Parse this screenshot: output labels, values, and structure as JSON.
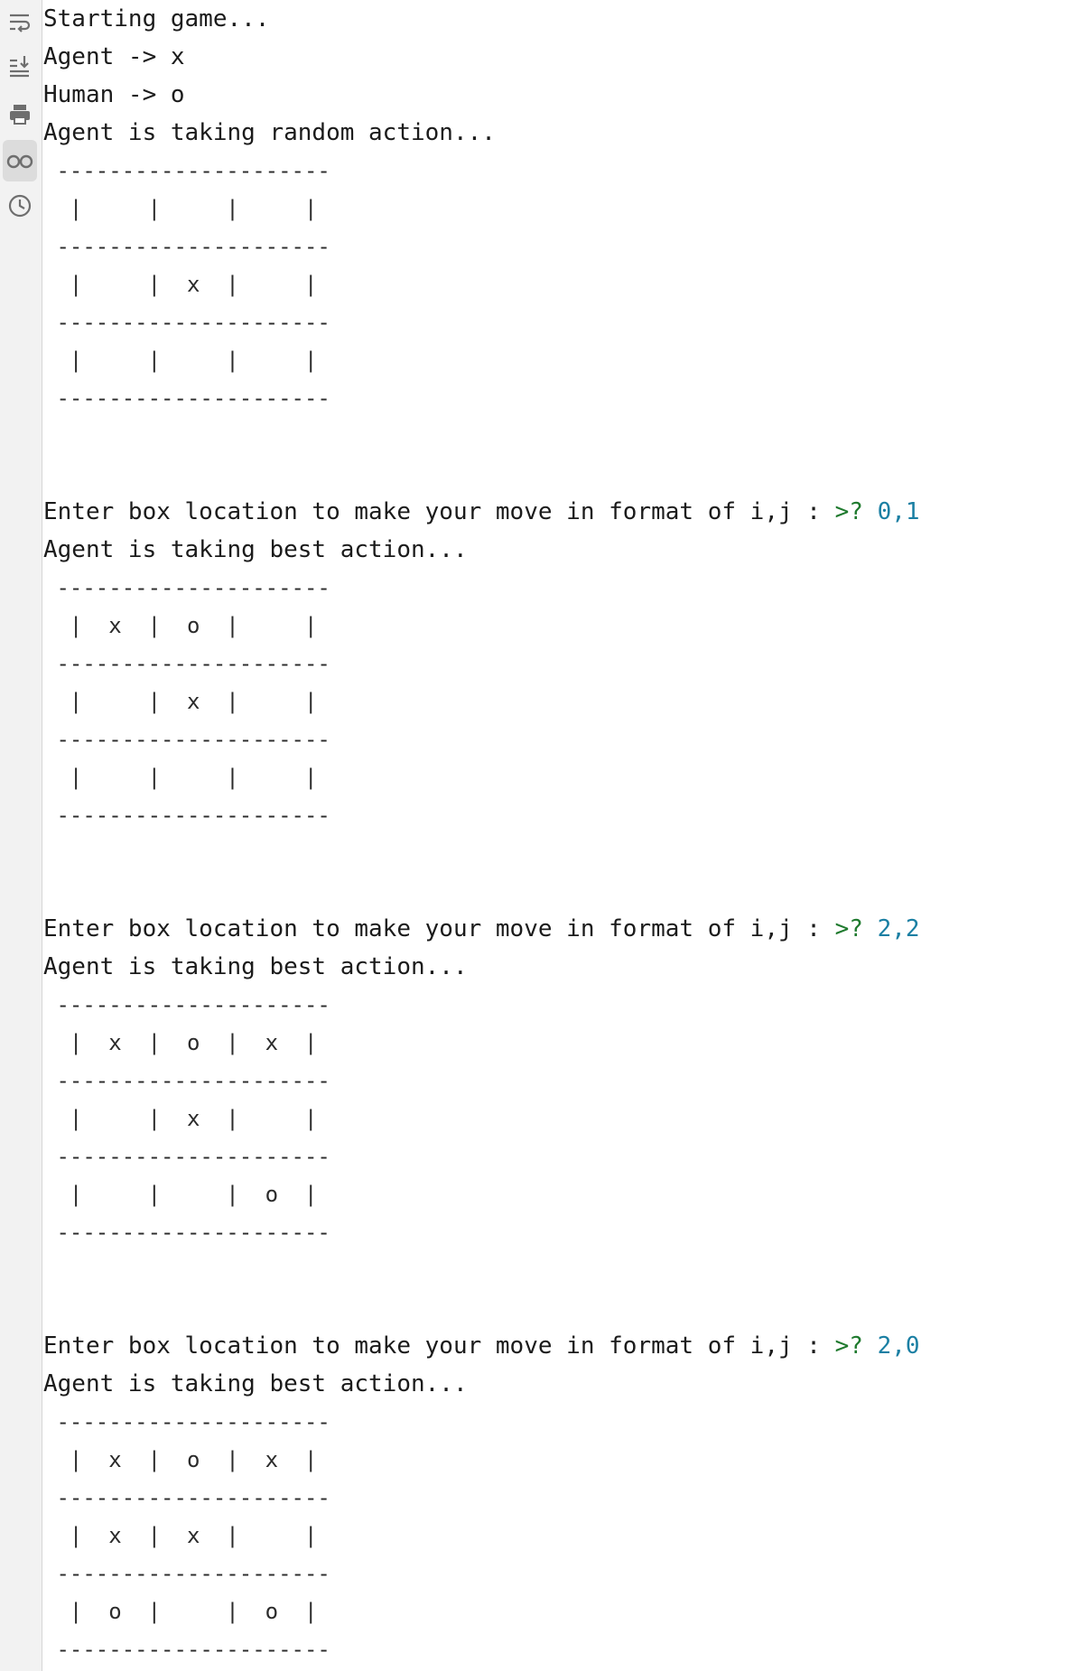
{
  "toolbar": {
    "icons": [
      {
        "name": "soft-wrap-icon",
        "active": false
      },
      {
        "name": "scroll-to-end-icon",
        "active": false
      },
      {
        "name": "print-icon",
        "active": false
      },
      {
        "name": "glasses-icon",
        "active": true
      },
      {
        "name": "history-icon",
        "active": false
      }
    ]
  },
  "console": {
    "lines": [
      {
        "text": "Starting game..."
      },
      {
        "text": "Agent -> x"
      },
      {
        "text": "Human -> o"
      },
      {
        "text": "Agent is taking random action..."
      },
      {
        "text": " ---------------------",
        "grid": true
      },
      {
        "text": "  |     |     |     |",
        "grid": true
      },
      {
        "text": " ---------------------",
        "grid": true
      },
      {
        "text": "  |     |  x  |     |",
        "grid": true
      },
      {
        "text": " ---------------------",
        "grid": true
      },
      {
        "text": "  |     |     |     |",
        "grid": true
      },
      {
        "text": " ---------------------",
        "grid": true
      },
      {
        "text": ""
      },
      {
        "text": ""
      },
      {
        "text": "Enter box location to make your move in format of i,j : ",
        "prompt": ">? ",
        "answer": "0,1"
      },
      {
        "text": "Agent is taking best action..."
      },
      {
        "text": " ---------------------",
        "grid": true
      },
      {
        "text": "  |  x  |  o  |     |",
        "grid": true
      },
      {
        "text": " ---------------------",
        "grid": true
      },
      {
        "text": "  |     |  x  |     |",
        "grid": true
      },
      {
        "text": " ---------------------",
        "grid": true
      },
      {
        "text": "  |     |     |     |",
        "grid": true
      },
      {
        "text": " ---------------------",
        "grid": true
      },
      {
        "text": ""
      },
      {
        "text": ""
      },
      {
        "text": "Enter box location to make your move in format of i,j : ",
        "prompt": ">? ",
        "answer": "2,2"
      },
      {
        "text": "Agent is taking best action..."
      },
      {
        "text": " ---------------------",
        "grid": true
      },
      {
        "text": "  |  x  |  o  |  x  |",
        "grid": true
      },
      {
        "text": " ---------------------",
        "grid": true
      },
      {
        "text": "  |     |  x  |     |",
        "grid": true
      },
      {
        "text": " ---------------------",
        "grid": true
      },
      {
        "text": "  |     |     |  o  |",
        "grid": true
      },
      {
        "text": " ---------------------",
        "grid": true
      },
      {
        "text": ""
      },
      {
        "text": ""
      },
      {
        "text": "Enter box location to make your move in format of i,j : ",
        "prompt": ">? ",
        "answer": "2,0"
      },
      {
        "text": "Agent is taking best action..."
      },
      {
        "text": " ---------------------",
        "grid": true
      },
      {
        "text": "  |  x  |  o  |  x  |",
        "grid": true
      },
      {
        "text": " ---------------------",
        "grid": true
      },
      {
        "text": "  |  x  |  x  |     |",
        "grid": true
      },
      {
        "text": " ---------------------",
        "grid": true
      },
      {
        "text": "  |  o  |     |  o  |",
        "grid": true
      },
      {
        "text": " ---------------------",
        "grid": true
      }
    ]
  }
}
